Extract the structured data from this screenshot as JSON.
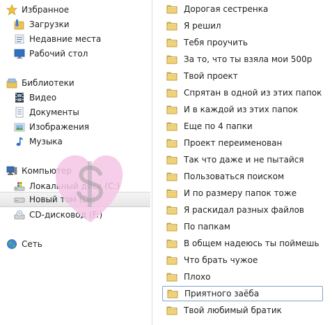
{
  "navigation": {
    "favorites": {
      "header": "Избранное",
      "items": [
        "Загрузки",
        "Недавние места",
        "Рабочий стол"
      ]
    },
    "libraries": {
      "header": "Библиотеки",
      "items": [
        "Видео",
        "Документы",
        "Изображения",
        "Музыка"
      ]
    },
    "computer": {
      "header": "Компьютер",
      "items": [
        "Локальный диск (C:)",
        "Новый том (D:)",
        "CD-дисковод (F:)"
      ],
      "selected": "Новый том (D:)"
    },
    "network": {
      "header": "Сеть"
    }
  },
  "folders": [
    "Дорогая сестренка",
    "Я решил",
    "Тебя проучить",
    "За то, что ты взяла мои 500р",
    "Твой проект",
    "Спрятан в одной из этих папок",
    "И в каждой из этих папок",
    "Еще по 4 папки",
    "Проект переименован",
    "Так что даже и не пытайся",
    "Пользоваться поиском",
    "И по размеру папок тоже",
    "Я раскидал разных файлов",
    "По папкам",
    "В общем надеюсь ты поймешь",
    "Что брать чужое",
    "Плохо",
    "Приятного заёба",
    "Твой любимый братик"
  ],
  "focused_folder": "Приятного заёба",
  "colors": {
    "folder": "#e8c45a",
    "selection_border": "#7da2ce",
    "watermark": "#f6c6e6"
  }
}
